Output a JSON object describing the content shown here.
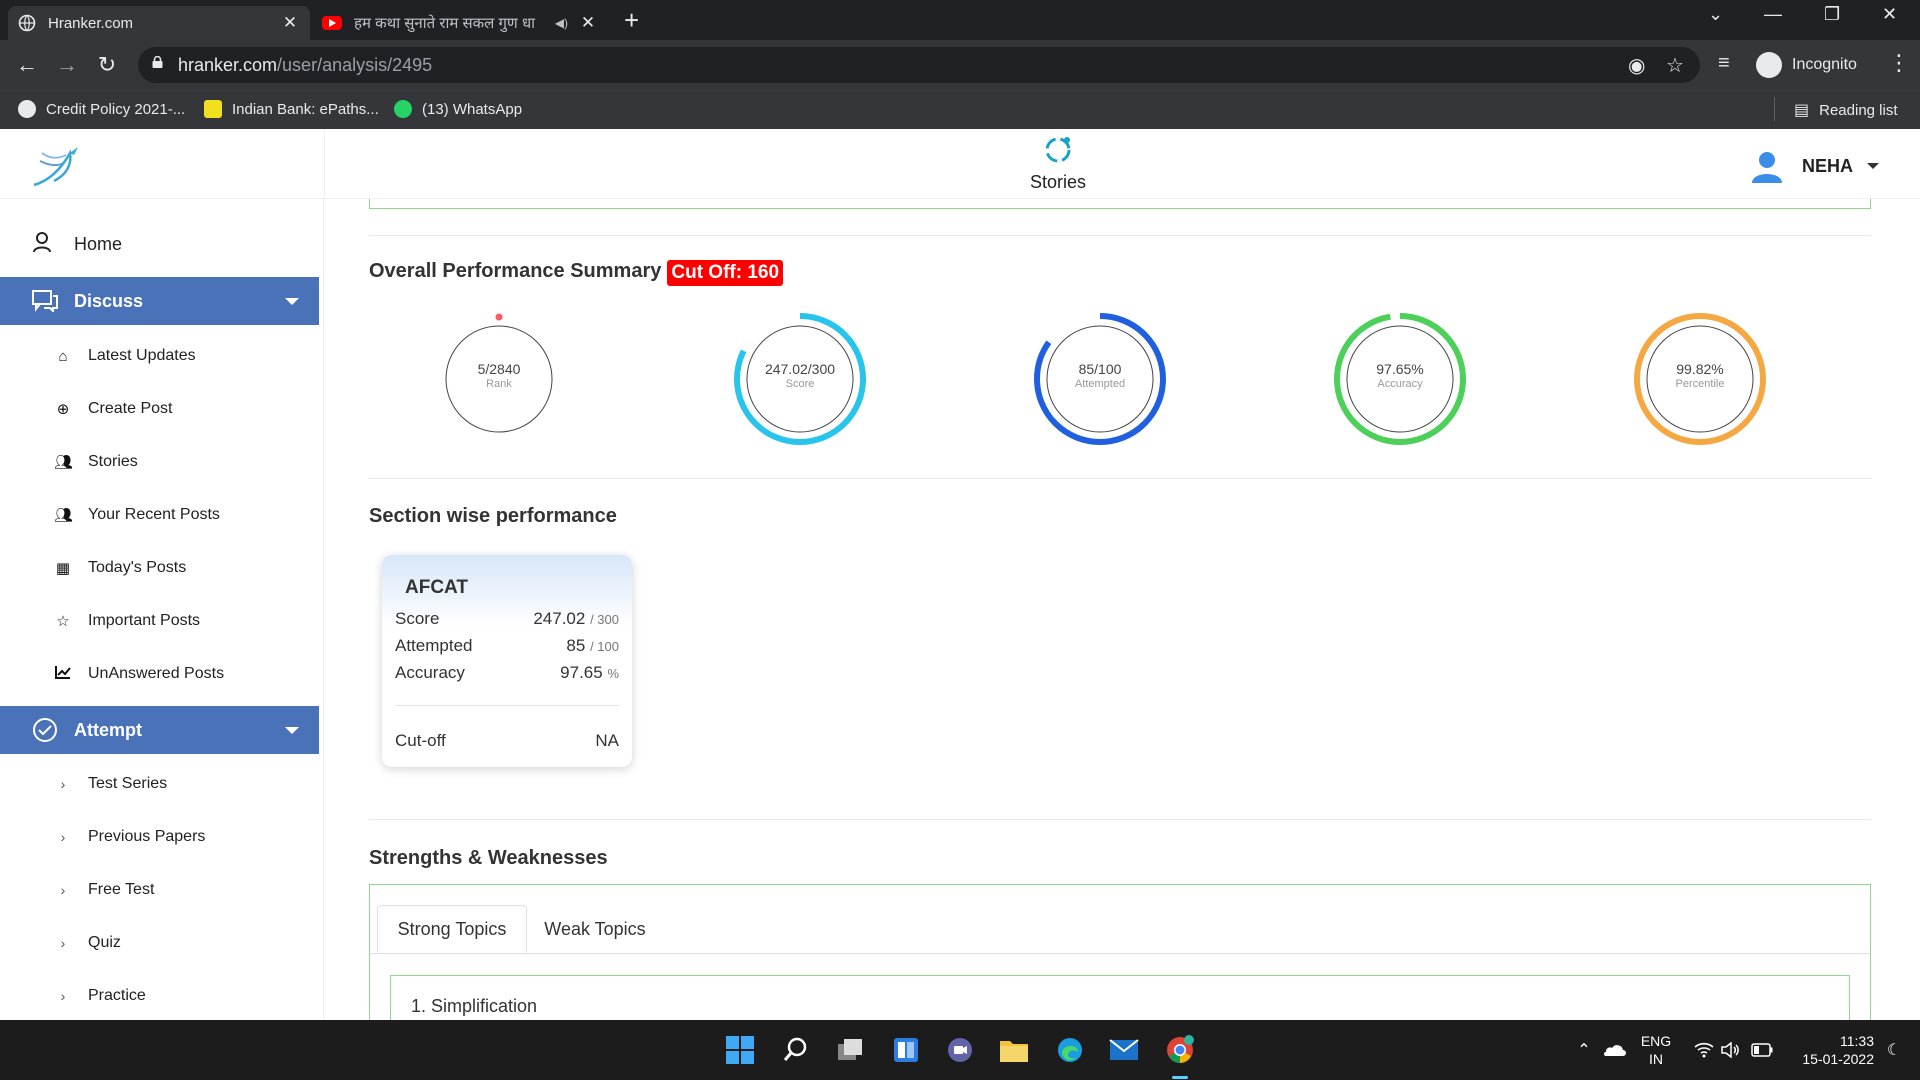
{
  "browser": {
    "tabs": [
      {
        "title": "Hranker.com",
        "active": true
      },
      {
        "title": "हम कथा सुनाते राम सकल गुण धा",
        "active": false
      }
    ],
    "url_host": "hranker.com",
    "url_path": "/user/analysis/2495",
    "profile_label": "Incognito",
    "bookmarks": [
      "Credit Policy 2021-...",
      "Indian Bank: ePaths...",
      "(13) WhatsApp"
    ],
    "reading_list": "Reading list"
  },
  "header": {
    "stories_label": "Stories",
    "user_name": "NEHA"
  },
  "sidebar": {
    "home": "Home",
    "discuss": {
      "label": "Discuss",
      "items": [
        "Latest Updates",
        "Create Post",
        "Stories",
        "Your Recent Posts",
        "Today's Posts",
        "Important Posts",
        "UnAnswered Posts"
      ]
    },
    "attempt": {
      "label": "Attempt",
      "items": [
        "Test Series",
        "Previous Papers",
        "Free Test",
        "Quiz",
        "Practice"
      ]
    }
  },
  "main": {
    "summary_title": "Overall Performance Summary",
    "cutoff_badge": "Cut Off: 160",
    "metrics": [
      {
        "value": "5/2840",
        "label": "Rank",
        "fraction": 0.0,
        "color": "#ff5a5f"
      },
      {
        "value": "247.02/300",
        "label": "Score",
        "fraction": 0.8234,
        "color": "#29c4ec"
      },
      {
        "value": "85/100",
        "label": "Attempted",
        "fraction": 0.85,
        "color": "#1f5fe0"
      },
      {
        "value": "97.65%",
        "label": "Accuracy",
        "fraction": 0.9765,
        "color": "#4cd05a"
      },
      {
        "value": "99.82%",
        "label": "Percentile",
        "fraction": 0.9982,
        "color": "#f5a742"
      }
    ],
    "section_title": "Section wise performance",
    "section_card": {
      "name": "AFCAT",
      "score_label": "Score",
      "score": "247.02",
      "score_max": "/ 300",
      "attempted_label": "Attempted",
      "attempted": "85",
      "attempted_max": "/ 100",
      "accuracy_label": "Accuracy",
      "accuracy": "97.65",
      "accuracy_unit": "%",
      "cutoff_label": "Cut-off",
      "cutoff": "NA"
    },
    "sw_title": "Strengths & Weaknesses",
    "sw_tabs": [
      "Strong Topics",
      "Weak Topics"
    ],
    "sw_first_topic": "1. Simplification"
  },
  "taskbar": {
    "lang_top": "ENG",
    "lang_bottom": "IN",
    "time": "11:33",
    "date": "15-01-2022"
  }
}
